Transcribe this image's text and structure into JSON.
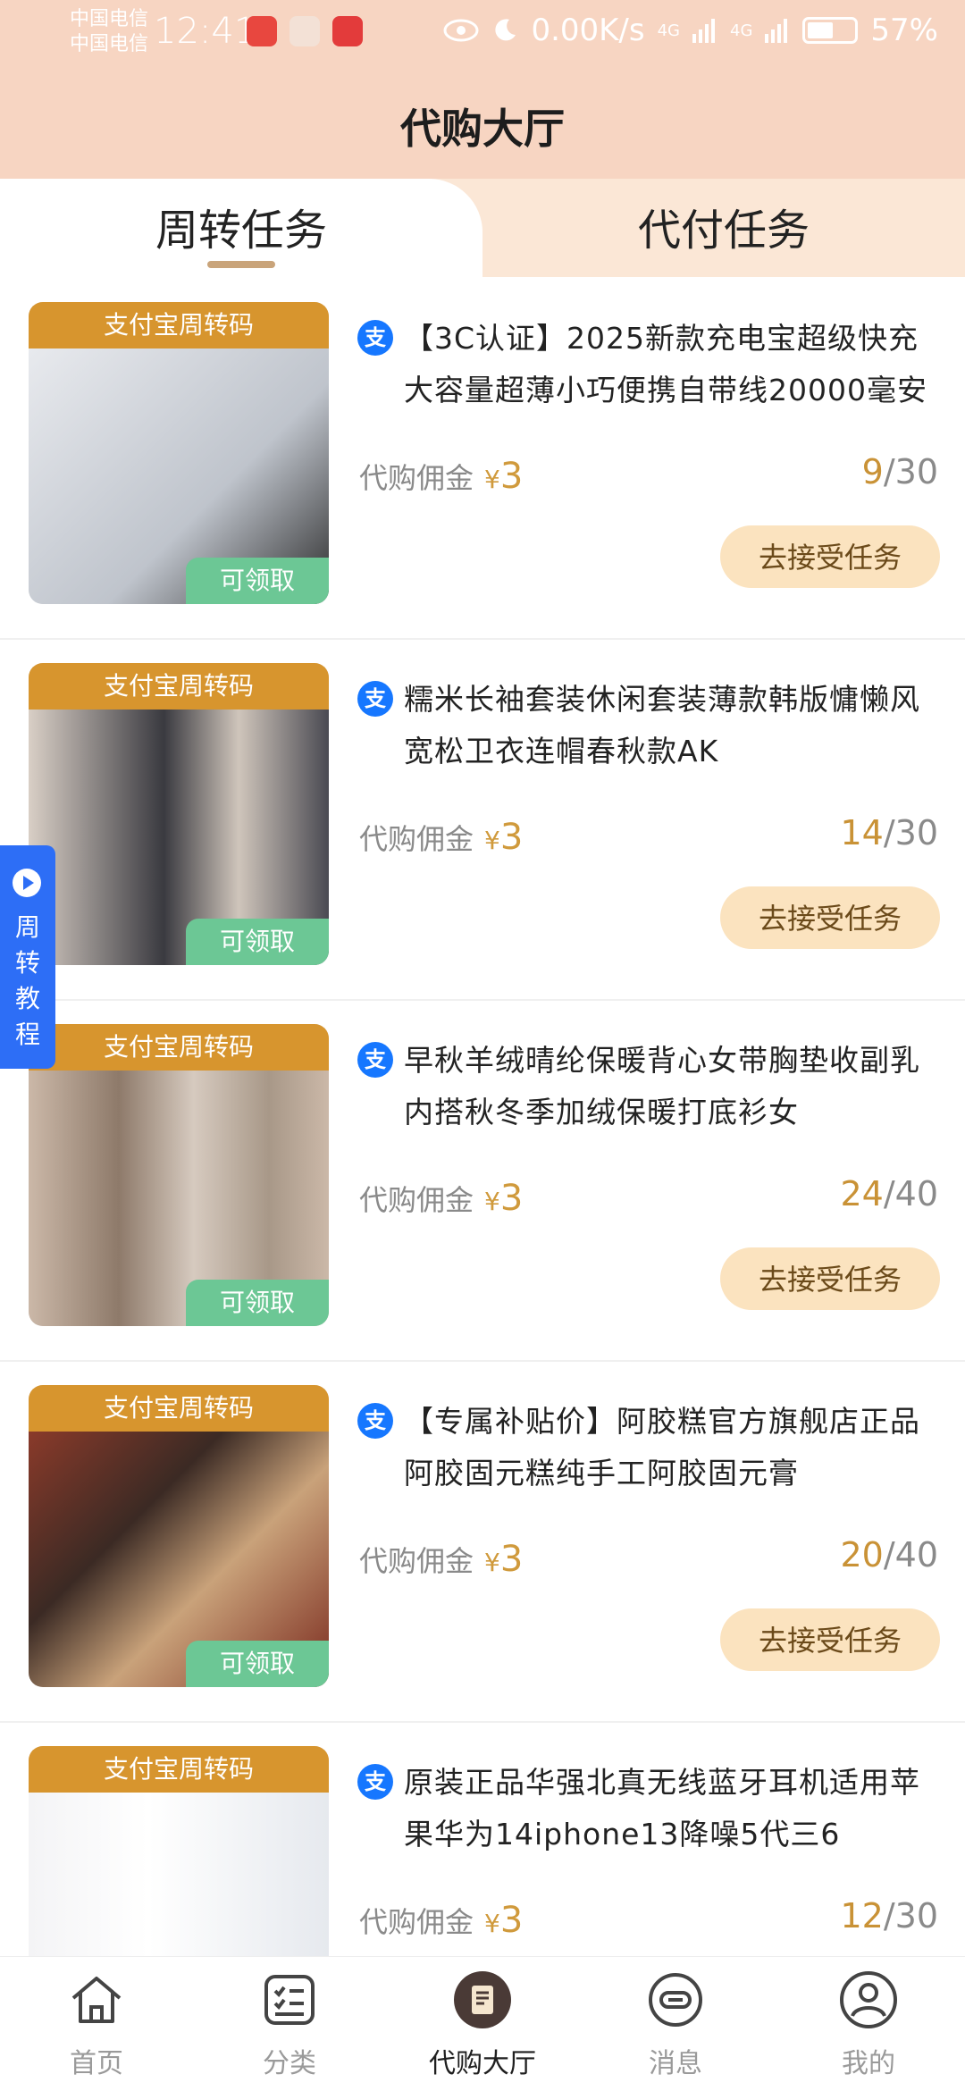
{
  "status_bar": {
    "carrier_line1": "中国电信",
    "carrier_line2": "中国电信",
    "time": "12:41",
    "net_speed": "0.00K/s",
    "signal1": "4G",
    "signal2": "4G",
    "battery": "57%"
  },
  "header": {
    "title": "代购大厅"
  },
  "tabs": [
    {
      "label": "周转任务",
      "active": true
    },
    {
      "label": "代付任务",
      "active": false
    }
  ],
  "side_tab": {
    "label": "周转教程"
  },
  "task_card_labels": {
    "thumb_top": "支付宝周转码",
    "badge": "可领取",
    "commission_label": "代购佣金",
    "currency": "¥",
    "accept_button": "去接受任务",
    "alipay_icon": "支"
  },
  "tasks": [
    {
      "title": "【3C认证】2025新款充电宝超级快充大容量超薄小巧便携自带线20000毫安",
      "commission": "3",
      "taken": "9",
      "total": "/30"
    },
    {
      "title": "糯米长袖套装休闲套装薄款韩版慵懒风宽松卫衣连帽春秋款AK",
      "commission": "3",
      "taken": "14",
      "total": "/30"
    },
    {
      "title": "早秋羊绒晴纶保暖背心女带胸垫收副乳内搭秋冬季加绒保暖打底衫女",
      "commission": "3",
      "taken": "24",
      "total": "/40"
    },
    {
      "title": "【专属补贴价】阿胶糕官方旗舰店正品阿胶固元糕纯手工阿胶固元膏",
      "commission": "3",
      "taken": "20",
      "total": "/40"
    },
    {
      "title": "原装正品华强北真无线蓝牙耳机适用苹果华为14iphone13降噪5代三6",
      "commission": "3",
      "taken": "12",
      "total": "/30"
    }
  ],
  "bottom_nav": [
    {
      "label": "首页",
      "icon": "home-icon"
    },
    {
      "label": "分类",
      "icon": "category-icon"
    },
    {
      "label": "代购大厅",
      "icon": "purchase-hall-icon"
    },
    {
      "label": "消息",
      "icon": "message-icon"
    },
    {
      "label": "我的",
      "icon": "profile-icon"
    }
  ],
  "colors": {
    "header_bg": "#f7d5c2",
    "thumb_top_bg": "#d7952e",
    "badge_bg": "#6cc795",
    "accent_gold": "#c99236",
    "button_bg": "#fbe3bf",
    "side_tab_bg": "#2d6ef6",
    "alipay_blue": "#1677ff"
  }
}
